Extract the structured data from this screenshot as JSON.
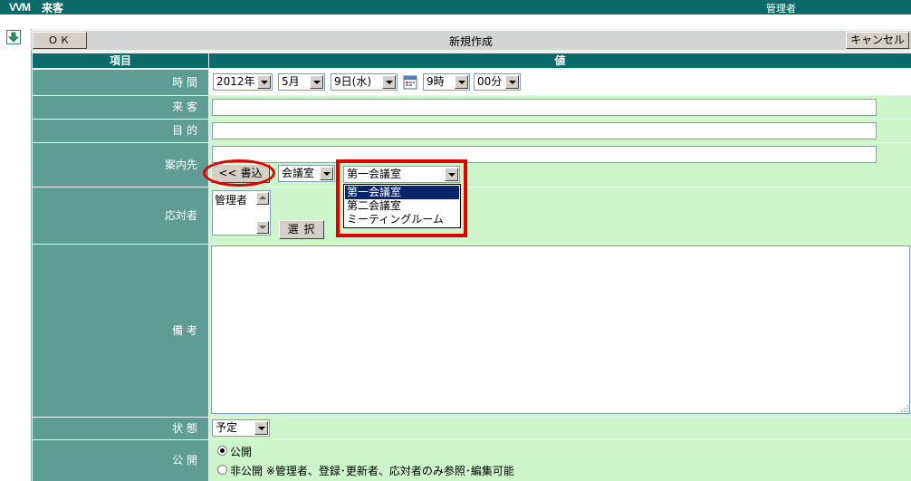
{
  "header": {
    "logo": "VVM",
    "title": "来客",
    "user": "管理者"
  },
  "toolbar": {
    "ok_label": "ＯＫ",
    "form_title": "新規作成",
    "cancel_label": "キャンセル"
  },
  "columns": {
    "item": "項目",
    "value": "値"
  },
  "fields": {
    "time": {
      "label": "時 間",
      "year": "2012年",
      "month": "5月",
      "day": "9日(水)",
      "hour": "9時",
      "minute": "00分"
    },
    "visitor": {
      "label": "来 客",
      "value": ""
    },
    "purpose": {
      "label": "目 的",
      "value": ""
    },
    "guide": {
      "label": "案内先",
      "value": "",
      "write_button": "<< 書込",
      "category": "会議室",
      "room": "第一会議室",
      "room_options": [
        "第一会議室",
        "第二会議室",
        "ミーティングルーム"
      ],
      "highlighted_index": 0
    },
    "responder": {
      "label": "応対者",
      "list_items": [
        "管理者"
      ],
      "select_button": "選 択"
    },
    "notes": {
      "label": "備 考",
      "value": ""
    },
    "status": {
      "label": "状 態",
      "value": "予定"
    },
    "visibility": {
      "label": "公 開",
      "options": [
        "公開",
        "非公開 ※管理者、登録･更新者、応対者のみ参照･編集可能"
      ],
      "selected_index": 0
    }
  },
  "colors": {
    "header_bg": "#0b6a6a",
    "label_bg": "#5f9c95",
    "value_bg": "#ccf5cc",
    "highlight": "#0a246a",
    "callout": "#e00000"
  }
}
